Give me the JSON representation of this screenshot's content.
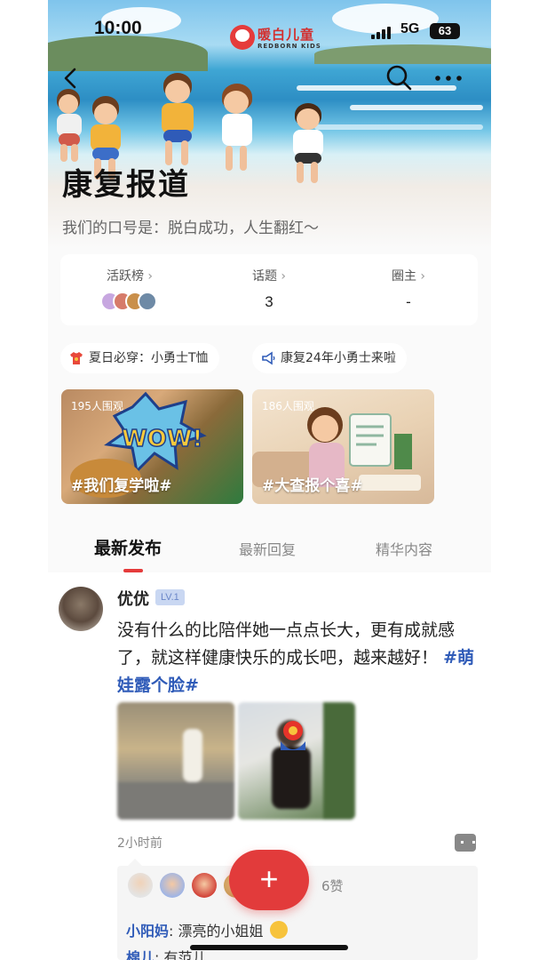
{
  "status_bar": {
    "time": "10:00",
    "network": "5G",
    "battery": "63"
  },
  "brand": {
    "name_cn": "暖白儿童",
    "name_en": "REDBORN KIDS"
  },
  "header": {
    "title": "康复报道",
    "slogan": "我们的口号是：脱白成功，人生翻红～"
  },
  "stats": {
    "items": [
      {
        "label": "活跃榜",
        "value": ""
      },
      {
        "label": "话题",
        "value": "3"
      },
      {
        "label": "圈主",
        "value": "-"
      }
    ]
  },
  "pinned": [
    {
      "label": "夏日必穿：小勇士T恤",
      "icon": "tshirt-icon"
    },
    {
      "label": "康复24年小勇士来啦",
      "icon": "megaphone-icon"
    }
  ],
  "topics": [
    {
      "views": "195人围观",
      "name": "#我们复学啦#"
    },
    {
      "views": "186人围观",
      "name": "#大查报个喜#"
    }
  ],
  "tabs": [
    {
      "label": "最新发布",
      "active": true
    },
    {
      "label": "最新回复",
      "active": false
    },
    {
      "label": "精华内容",
      "active": false
    }
  ],
  "post": {
    "user": "优优",
    "level": "LV.1",
    "text": "没有什么的比陪伴她一点点长大，更有成就感了，就这样健康快乐的成长吧，越来越好！",
    "tag": "#萌娃露个脸#",
    "time": "2小时前",
    "likes": "6赞",
    "comments": [
      {
        "user": "小阳妈",
        "text": ": 漂亮的小姐姐"
      },
      {
        "user": "棉儿",
        "text": ": 有范儿"
      }
    ]
  },
  "fab": {
    "label": "+"
  },
  "colors": {
    "accent": "#e23b3b",
    "link": "#2f5bb8",
    "level_badge": "#c9d7f2"
  }
}
